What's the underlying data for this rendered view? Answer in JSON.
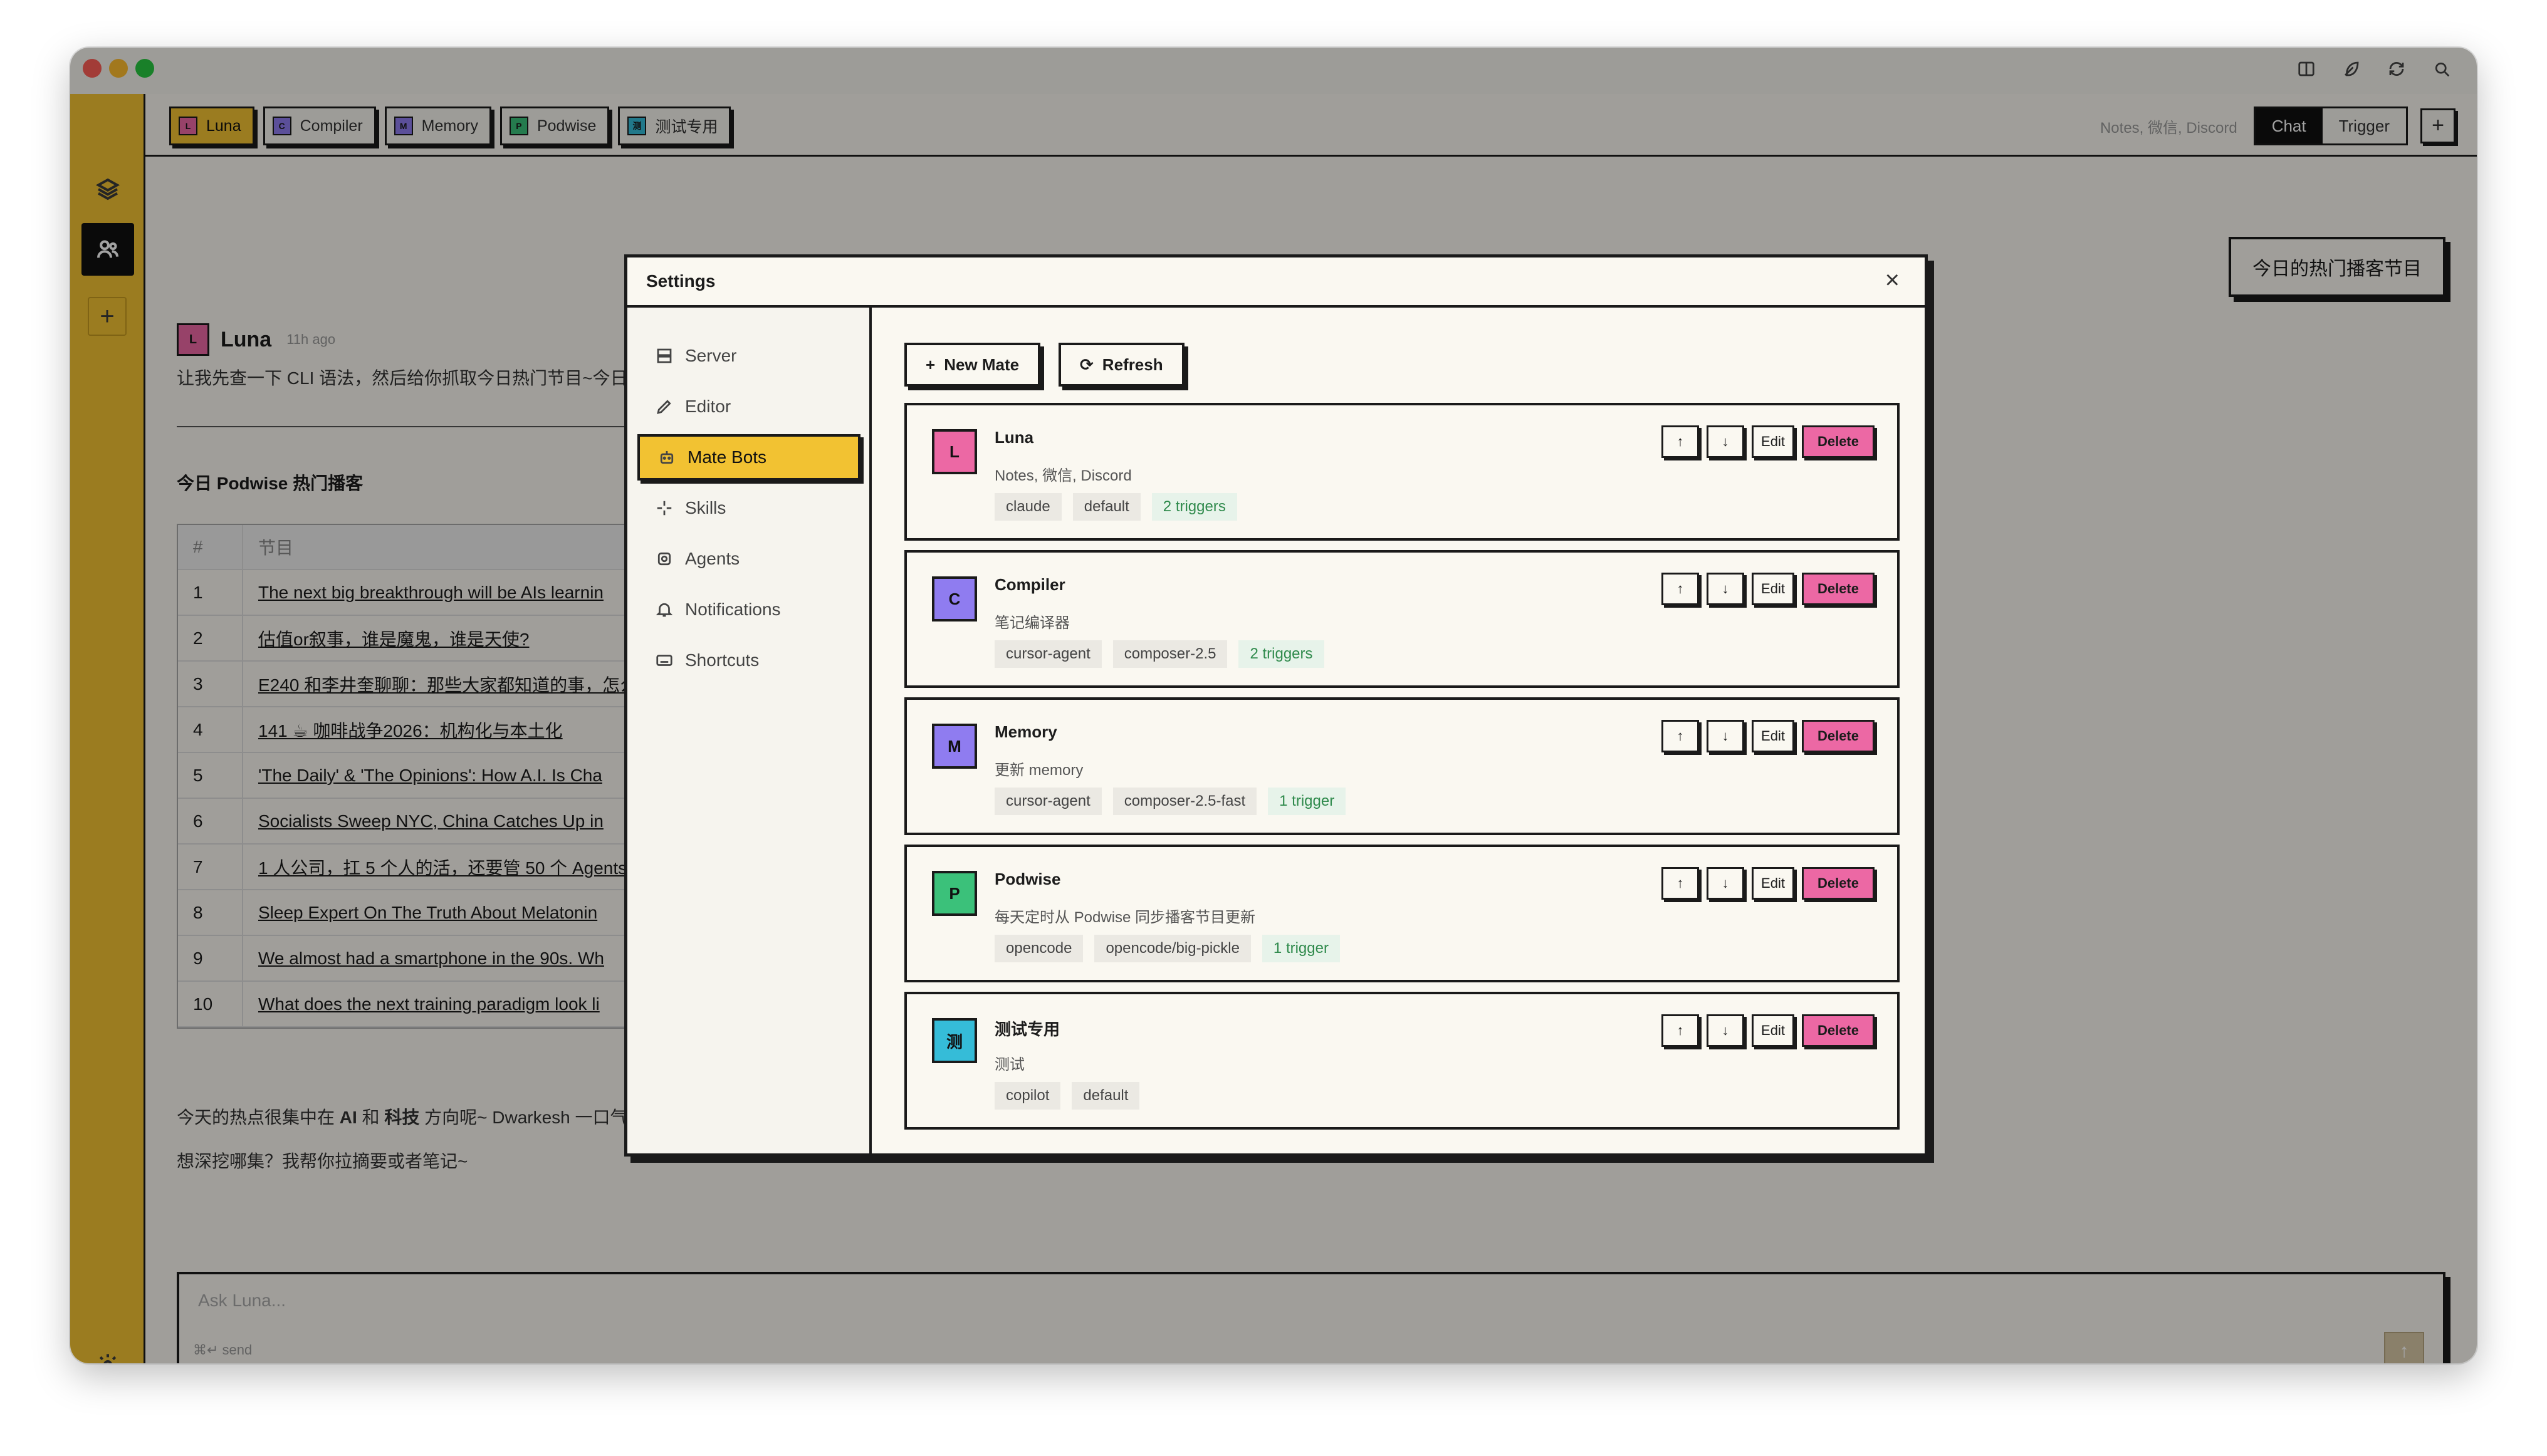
{
  "tabs": [
    {
      "label": "Luna",
      "initial": "L",
      "color": "#ec68a4",
      "active": true
    },
    {
      "label": "Compiler",
      "initial": "C",
      "color": "#8f7cf0",
      "active": false
    },
    {
      "label": "Memory",
      "initial": "M",
      "color": "#8f7cf0",
      "active": false
    },
    {
      "label": "Podwise",
      "initial": "P",
      "color": "#3bc17a",
      "active": false
    },
    {
      "label": "测试专用",
      "initial": "测",
      "color": "#35bcd8",
      "active": false
    }
  ],
  "tabbar": {
    "meta": "Notes, 微信, Discord",
    "chat": "Chat",
    "trigger": "Trigger",
    "plus": "+"
  },
  "today_button": "今日的热门播客节目",
  "message": {
    "avatar_initial": "L",
    "name": "Luna",
    "time": "11h ago",
    "intro": "让我先查一下 CLI 语法，然后给你抓取今日热门节目~今日",
    "section_title": "今日 Podwise 热门播客",
    "table_headers": [
      "#",
      "节目"
    ],
    "rows": [
      {
        "num": "1",
        "title": "The next big breakthrough will be AIs learnin"
      },
      {
        "num": "2",
        "title": "估值or叙事，谁是魔鬼，谁是天使?"
      },
      {
        "num": "3",
        "title": "E240 和李井奎聊聊：那些大家都知道的事，怎么"
      },
      {
        "num": "4",
        "title": "141 ☕ 咖啡战争2026：机构化与本土化"
      },
      {
        "num": "5",
        "title": "'The Daily' & 'The Opinions': How A.I. Is Cha"
      },
      {
        "num": "6",
        "title": "Socialists Sweep NYC, China Catches Up in"
      },
      {
        "num": "7",
        "title": "1 人公司，扛 5 个人的活，还要管 50 个 Agents"
      },
      {
        "num": "8",
        "title": "Sleep Expert On The Truth About Melatonin"
      },
      {
        "num": "9",
        "title": "We almost had a smartphone in the 90s. Wh"
      },
      {
        "num": "10",
        "title": "What does the next training paradigm look li"
      }
    ],
    "summary_prefix": "今天的热点很集中在 ",
    "summary_ai": "AI",
    "summary_and": " 和 ",
    "summary_tech": "科技",
    "summary_suffix": " 方向呢~ Dwarkesh 一口气",
    "followup": "想深挖哪集？我帮你拉摘要或者笔记~"
  },
  "composer": {
    "placeholder": "Ask Luna...",
    "hint": "⌘↵ send",
    "send_icon": "arrow-up-icon"
  },
  "modal": {
    "title": "Settings",
    "close": "×",
    "nav": [
      {
        "label": "Server",
        "icon": "server-icon",
        "active": false
      },
      {
        "label": "Editor",
        "icon": "pencil-icon",
        "active": false
      },
      {
        "label": "Mate Bots",
        "icon": "bot-icon",
        "active": true
      },
      {
        "label": "Skills",
        "icon": "sparkle-icon",
        "active": false
      },
      {
        "label": "Agents",
        "icon": "agent-icon",
        "active": false
      },
      {
        "label": "Notifications",
        "icon": "bell-icon",
        "active": false
      },
      {
        "label": "Shortcuts",
        "icon": "keyboard-icon",
        "active": false
      }
    ],
    "new_mate": "New Mate",
    "refresh": "Refresh",
    "mates": [
      {
        "initial": "L",
        "name": "Luna",
        "desc": "Notes, 微信, Discord",
        "tags": [
          "claude",
          "default"
        ],
        "triggers": "2 triggers",
        "color": "#ec68a4"
      },
      {
        "initial": "C",
        "name": "Compiler",
        "desc": "笔记编译器",
        "tags": [
          "cursor-agent",
          "composer-2.5"
        ],
        "triggers": "2 triggers",
        "color": "#8f7cf0"
      },
      {
        "initial": "M",
        "name": "Memory",
        "desc": "更新 memory",
        "tags": [
          "cursor-agent",
          "composer-2.5-fast"
        ],
        "triggers": "1 trigger",
        "color": "#8f7cf0"
      },
      {
        "initial": "P",
        "name": "Podwise",
        "desc": "每天定时从 Podwise 同步播客节目更新",
        "tags": [
          "opencode",
          "opencode/big-pickle"
        ],
        "triggers": "1 trigger",
        "color": "#3bc17a"
      },
      {
        "initial": "测",
        "name": "测试专用",
        "desc": "测试",
        "tags": [
          "copilot",
          "default"
        ],
        "triggers": "",
        "color": "#35bcd8"
      }
    ],
    "ctrl_up": "↑",
    "ctrl_down": "↓",
    "ctrl_edit": "Edit",
    "ctrl_delete": "Delete"
  },
  "colors": {
    "accent": "#f2c232",
    "delete": "#ec68a4",
    "trigger_text": "#2f8a4c"
  }
}
